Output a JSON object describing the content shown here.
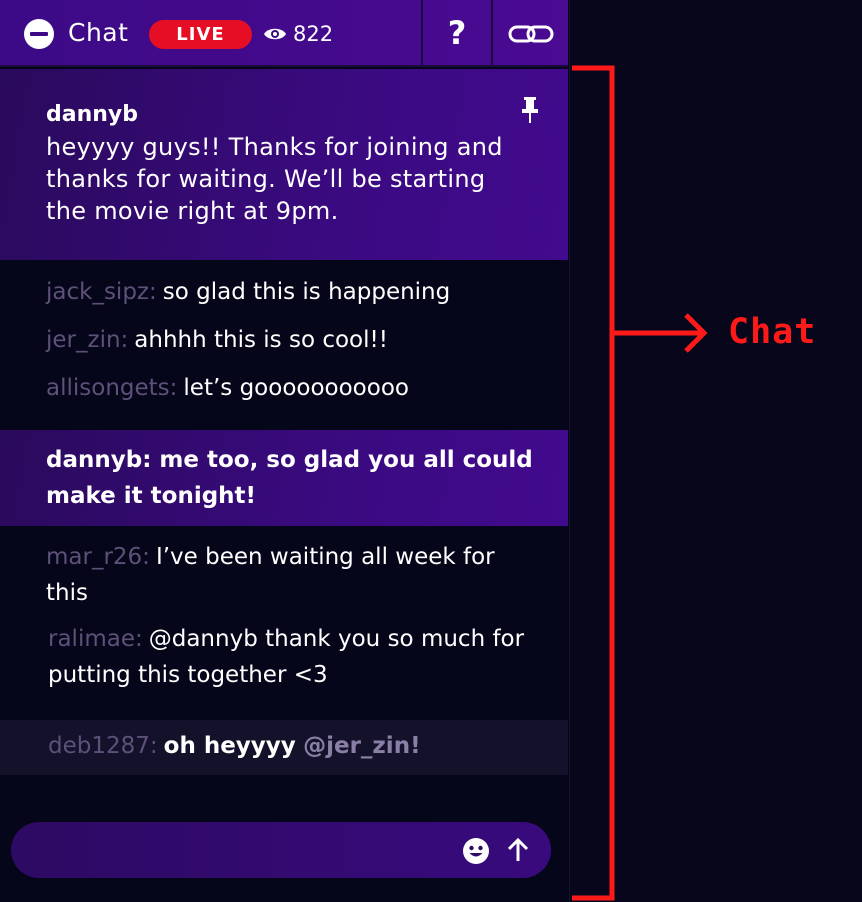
{
  "header": {
    "title": "Chat",
    "live_label": "LIVE",
    "viewer_count": "822",
    "help_label": "?"
  },
  "pinned": {
    "user": "dannyb",
    "text": "heyyyy guys!! Thanks for joining and thanks for waiting. We’ll be starting the movie right at 9pm."
  },
  "messages": [
    {
      "user": "jack_sipz:",
      "text": "so glad this is happening"
    },
    {
      "user": "jer_zin:",
      "text": "ahhhh this is so cool!!"
    },
    {
      "user": "allisongets:",
      "text": "let’s gooooooooooo"
    },
    {
      "user": "mar_r26:",
      "text": "I’ve been waiting all week for this"
    },
    {
      "user": "ralimae:",
      "text": "@dannyb thank you so much for putting this together <3"
    }
  ],
  "host_message": {
    "text": "dannyb: me too, so glad you all could make it tonight!"
  },
  "self_message": {
    "user": "deb1287:",
    "text": "oh heyyyy",
    "mention": "@jer_zin!"
  },
  "input": {
    "placeholder": ""
  },
  "annotation": {
    "label": "Chat",
    "color": "#ff1a1a"
  },
  "colors": {
    "accent": "#420a8e",
    "live": "#e60e25",
    "username": "#5d5079",
    "background": "#07061a"
  }
}
